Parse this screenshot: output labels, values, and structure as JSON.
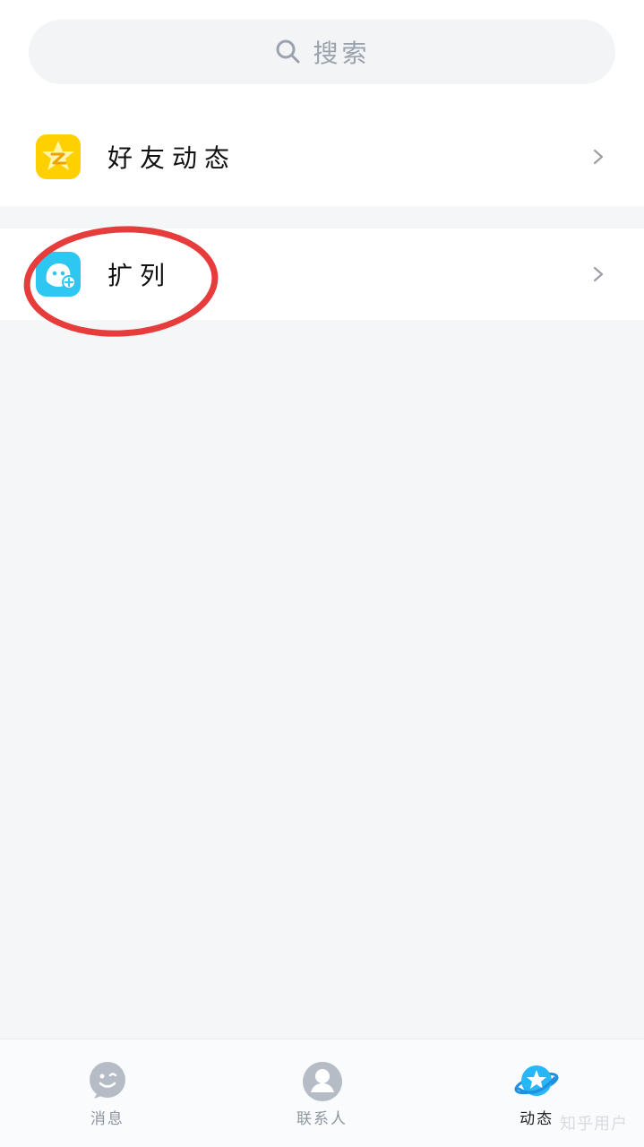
{
  "search": {
    "placeholder": "搜索"
  },
  "menu": {
    "items": [
      {
        "label": "好友动态",
        "icon": "qzone-star-icon"
      },
      {
        "label": "扩列",
        "icon": "add-friend-icon"
      }
    ]
  },
  "bottom_nav": {
    "tabs": [
      {
        "label": "消息",
        "icon": "message-icon",
        "active": false
      },
      {
        "label": "联系人",
        "icon": "contacts-icon",
        "active": false
      },
      {
        "label": "动态",
        "icon": "planet-icon",
        "active": true
      }
    ]
  },
  "watermark": "知乎用户",
  "colors": {
    "accent_blue": "#2ec7f1",
    "qzone_yellow": "#ffd000",
    "annotation_red": "#e63c3c",
    "background": "#f4f6f8"
  }
}
